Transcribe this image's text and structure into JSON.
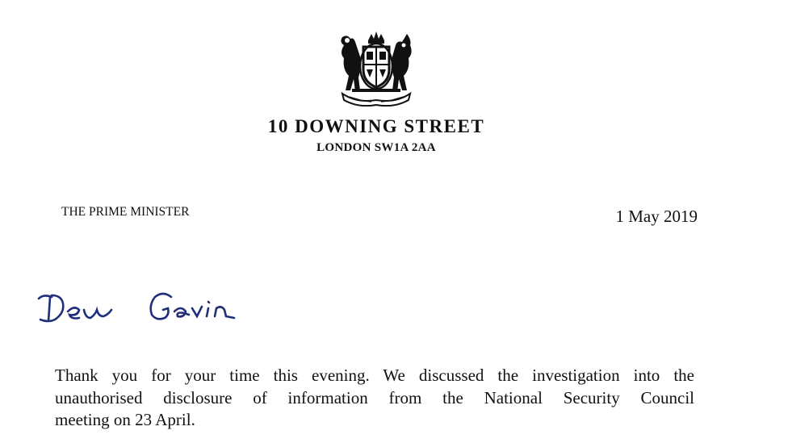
{
  "letterhead": {
    "crest_icon": "royal-coat-of-arms-icon",
    "address_line1": "10 DOWNING STREET",
    "address_line2": "LONDON SW1A 2AA"
  },
  "sender": "THE PRIME MINISTER",
  "date": "1 May 2019",
  "salutation": "Dear Gavin",
  "body": {
    "lines": [
      "Thank you for your time this evening. We discussed the investigation into the",
      "unauthorised disclosure of information from the National Security Council",
      "meeting on 23 April."
    ]
  },
  "colors": {
    "ink": "#111111",
    "signature_ink": "#1f2f7a",
    "paper": "#ffffff"
  }
}
